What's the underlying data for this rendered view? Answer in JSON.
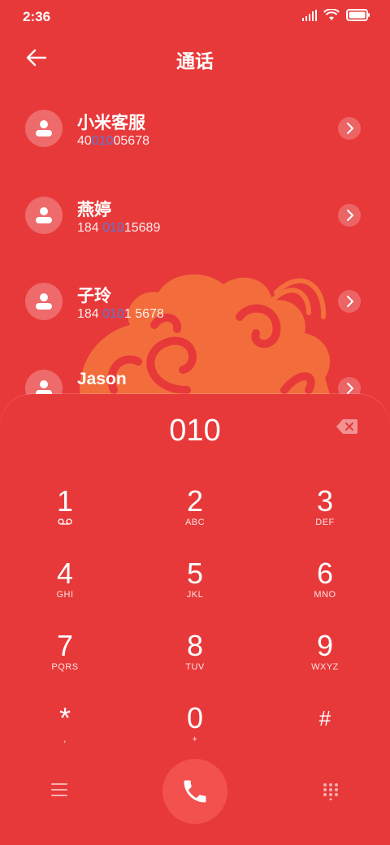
{
  "status": {
    "time": "2:36"
  },
  "header": {
    "title": "通话"
  },
  "contacts": [
    {
      "name": "小米客服",
      "num_pre": "40",
      "num_hl": "010",
      "num_post": "05678"
    },
    {
      "name": "燕婷",
      "num_pre": "184 ",
      "num_hl": "010",
      "num_post": "15689"
    },
    {
      "name": "子玲",
      "num_pre": "184 ",
      "num_hl": "010",
      "num_post": "1 5678"
    },
    {
      "name": "Jason",
      "num_pre": "",
      "num_hl": "",
      "num_post": ""
    }
  ],
  "dialpad": {
    "entry": "010",
    "keys": [
      {
        "digit": "1",
        "letters": ""
      },
      {
        "digit": "2",
        "letters": "ABC"
      },
      {
        "digit": "3",
        "letters": "DEF"
      },
      {
        "digit": "4",
        "letters": "GHI"
      },
      {
        "digit": "5",
        "letters": "JKL"
      },
      {
        "digit": "6",
        "letters": "MNO"
      },
      {
        "digit": "7",
        "letters": "PQRS"
      },
      {
        "digit": "8",
        "letters": "TUV"
      },
      {
        "digit": "9",
        "letters": "WXYZ"
      },
      {
        "digit": "*",
        "letters": ","
      },
      {
        "digit": "0",
        "letters": "+"
      },
      {
        "digit": "#",
        "letters": ""
      }
    ]
  },
  "icons": {
    "back": "arrow-left-icon",
    "backspace": "backspace-icon",
    "call": "phone-icon",
    "menu": "menu-icon",
    "keypad": "keypad-icon",
    "voicemail": "voicemail-icon"
  },
  "colors": {
    "background": "#e8393a",
    "call_button": "#f2514e",
    "highlight": "#5a78d8",
    "art": "#f3703c"
  }
}
